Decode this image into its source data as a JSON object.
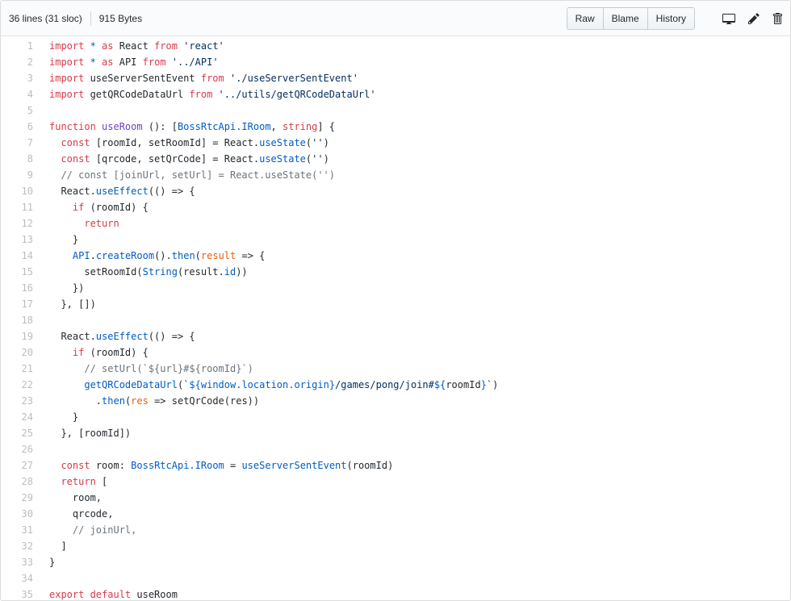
{
  "file_header": {
    "lines_info": "36 lines (31 sloc)",
    "size_info": "915 Bytes",
    "buttons": [
      "Raw",
      "Blame",
      "History"
    ],
    "icons": [
      "device-desktop-icon",
      "pencil-icon",
      "trash-icon"
    ]
  },
  "colors": {
    "keyword": "#d73a49",
    "string": "#032f62",
    "call": "#005cc5",
    "definition": "#6f42c1",
    "comment": "#6a737d",
    "plain": "#24292e",
    "parameter": "#e36209"
  },
  "code": {
    "lines": [
      {
        "n": 1,
        "s": [
          [
            "k",
            "import "
          ],
          [
            "f",
            "*"
          ],
          [
            "k",
            " as "
          ],
          [
            "p",
            "React "
          ],
          [
            "k",
            "from "
          ],
          [
            "s",
            "'react'"
          ]
        ]
      },
      {
        "n": 2,
        "s": [
          [
            "k",
            "import "
          ],
          [
            "f",
            "*"
          ],
          [
            "k",
            " as "
          ],
          [
            "p",
            "API "
          ],
          [
            "k",
            "from "
          ],
          [
            "s",
            "'../API'"
          ]
        ]
      },
      {
        "n": 3,
        "s": [
          [
            "k",
            "import "
          ],
          [
            "p",
            "useServerSentEvent "
          ],
          [
            "k",
            "from "
          ],
          [
            "s",
            "'./useServerSentEvent'"
          ]
        ]
      },
      {
        "n": 4,
        "s": [
          [
            "k",
            "import "
          ],
          [
            "p",
            "getQRCodeDataUrl "
          ],
          [
            "k",
            "from "
          ],
          [
            "s",
            "'../utils/getQRCodeDataUrl'"
          ]
        ]
      },
      {
        "n": 5,
        "s": []
      },
      {
        "n": 6,
        "s": [
          [
            "k",
            "function "
          ],
          [
            "u",
            "useRoom "
          ],
          [
            "p",
            "(): ["
          ],
          [
            "f",
            "BossRtcApi.IRoom"
          ],
          [
            "p",
            ", "
          ],
          [
            "k",
            "string"
          ],
          [
            "p",
            "] {"
          ]
        ]
      },
      {
        "n": 7,
        "s": [
          [
            "p",
            "  "
          ],
          [
            "k",
            "const "
          ],
          [
            "p",
            "[roomId, setRoomId] = React."
          ],
          [
            "f",
            "useState"
          ],
          [
            "p",
            "("
          ],
          [
            "s",
            "''"
          ],
          [
            "p",
            ")"
          ]
        ]
      },
      {
        "n": 8,
        "s": [
          [
            "p",
            "  "
          ],
          [
            "k",
            "const "
          ],
          [
            "p",
            "[qrcode, setQrCode] = React."
          ],
          [
            "f",
            "useState"
          ],
          [
            "p",
            "("
          ],
          [
            "s",
            "''"
          ],
          [
            "p",
            ")"
          ]
        ]
      },
      {
        "n": 9,
        "s": [
          [
            "c",
            "  // const [joinUrl, setUrl] = React.useState('')"
          ]
        ]
      },
      {
        "n": 10,
        "s": [
          [
            "p",
            "  React."
          ],
          [
            "f",
            "useEffect"
          ],
          [
            "p",
            "(() => {"
          ]
        ]
      },
      {
        "n": 11,
        "s": [
          [
            "p",
            "    "
          ],
          [
            "k",
            "if"
          ],
          [
            "p",
            " (roomId) {"
          ]
        ]
      },
      {
        "n": 12,
        "s": [
          [
            "p",
            "      "
          ],
          [
            "k",
            "return"
          ]
        ]
      },
      {
        "n": 13,
        "s": [
          [
            "p",
            "    }"
          ]
        ]
      },
      {
        "n": 14,
        "s": [
          [
            "p",
            "    "
          ],
          [
            "f",
            "API"
          ],
          [
            "p",
            "."
          ],
          [
            "f",
            "createRoom"
          ],
          [
            "p",
            "()."
          ],
          [
            "f",
            "then"
          ],
          [
            "p",
            "("
          ],
          [
            "o",
            "result"
          ],
          [
            "p",
            " => {"
          ]
        ]
      },
      {
        "n": 15,
        "s": [
          [
            "p",
            "      setRoomId("
          ],
          [
            "f",
            "String"
          ],
          [
            "p",
            "(result."
          ],
          [
            "f",
            "id"
          ],
          [
            "p",
            "))"
          ]
        ]
      },
      {
        "n": 16,
        "s": [
          [
            "p",
            "    })"
          ]
        ]
      },
      {
        "n": 17,
        "s": [
          [
            "p",
            "  }, [])"
          ]
        ]
      },
      {
        "n": 18,
        "s": []
      },
      {
        "n": 19,
        "s": [
          [
            "p",
            "  React."
          ],
          [
            "f",
            "useEffect"
          ],
          [
            "p",
            "(() => {"
          ]
        ]
      },
      {
        "n": 20,
        "s": [
          [
            "p",
            "    "
          ],
          [
            "k",
            "if"
          ],
          [
            "p",
            " (roomId) {"
          ]
        ]
      },
      {
        "n": 21,
        "s": [
          [
            "c",
            "      // setUrl(`${url}#${roomId}`)"
          ]
        ]
      },
      {
        "n": 22,
        "s": [
          [
            "p",
            "      "
          ],
          [
            "f",
            "getQRCodeDataUrl"
          ],
          [
            "p",
            "("
          ],
          [
            "s",
            "`"
          ],
          [
            "f",
            "${window.location.origin}"
          ],
          [
            "s",
            "/games/pong/join#"
          ],
          [
            "f",
            "${"
          ],
          [
            "p",
            "roomId"
          ],
          [
            "f",
            "}"
          ],
          [
            "s",
            "`"
          ],
          [
            "p",
            ")"
          ]
        ]
      },
      {
        "n": 23,
        "s": [
          [
            "p",
            "        ."
          ],
          [
            "f",
            "then"
          ],
          [
            "p",
            "("
          ],
          [
            "o",
            "res"
          ],
          [
            "p",
            " => setQrCode(res))"
          ]
        ]
      },
      {
        "n": 24,
        "s": [
          [
            "p",
            "    }"
          ]
        ]
      },
      {
        "n": 25,
        "s": [
          [
            "p",
            "  }, [roomId])"
          ]
        ]
      },
      {
        "n": 26,
        "s": []
      },
      {
        "n": 27,
        "s": [
          [
            "p",
            "  "
          ],
          [
            "k",
            "const "
          ],
          [
            "p",
            "room: "
          ],
          [
            "f",
            "BossRtcApi.IRoom"
          ],
          [
            "p",
            " = "
          ],
          [
            "f",
            "useServerSentEvent"
          ],
          [
            "p",
            "(roomId)"
          ]
        ]
      },
      {
        "n": 28,
        "s": [
          [
            "p",
            "  "
          ],
          [
            "k",
            "return"
          ],
          [
            "p",
            " ["
          ]
        ]
      },
      {
        "n": 29,
        "s": [
          [
            "p",
            "    room,"
          ]
        ]
      },
      {
        "n": 30,
        "s": [
          [
            "p",
            "    qrcode,"
          ]
        ]
      },
      {
        "n": 31,
        "s": [
          [
            "c",
            "    // joinUrl,"
          ]
        ]
      },
      {
        "n": 32,
        "s": [
          [
            "p",
            "  ]"
          ]
        ]
      },
      {
        "n": 33,
        "s": [
          [
            "p",
            "}"
          ]
        ]
      },
      {
        "n": 34,
        "s": []
      },
      {
        "n": 35,
        "s": [
          [
            "k",
            "export "
          ],
          [
            "k",
            "default "
          ],
          [
            "p",
            "useRoom"
          ]
        ]
      }
    ]
  }
}
